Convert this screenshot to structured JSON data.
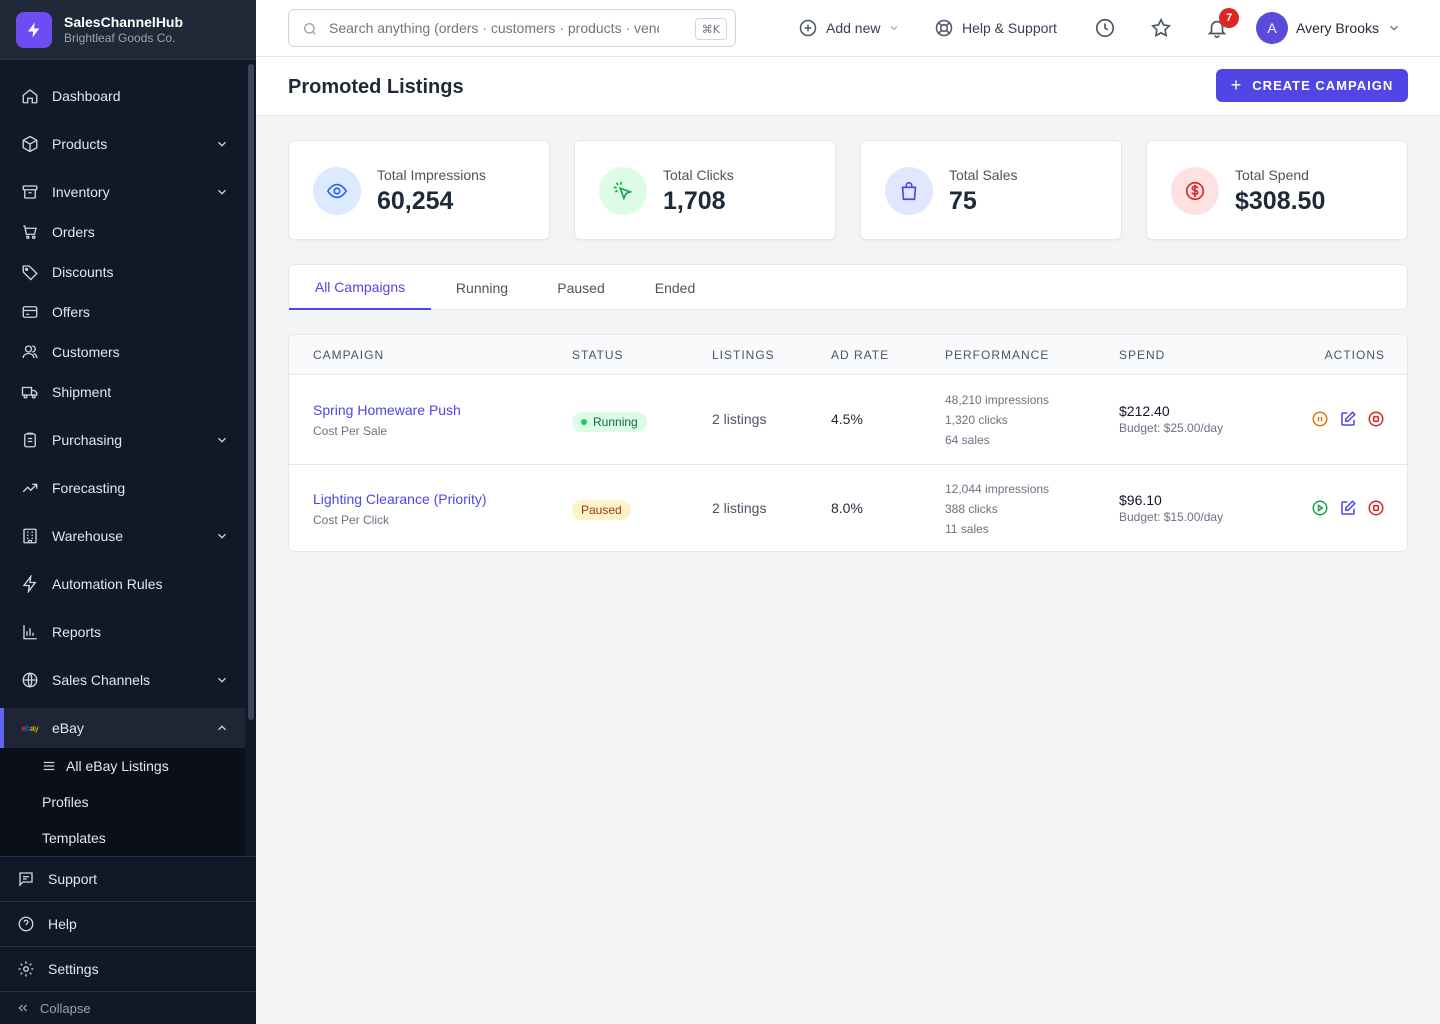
{
  "brand": {
    "name": "SalesChannelHub",
    "company": "Brightleaf Goods Co."
  },
  "sidebar": {
    "items": [
      {
        "label": "Dashboard"
      },
      {
        "label": "Products"
      },
      {
        "label": "Inventory"
      },
      {
        "label": "Orders"
      },
      {
        "label": "Discounts"
      },
      {
        "label": "Offers"
      },
      {
        "label": "Customers"
      },
      {
        "label": "Shipment"
      },
      {
        "label": "Purchasing"
      },
      {
        "label": "Forecasting"
      },
      {
        "label": "Warehouse"
      },
      {
        "label": "Automation Rules"
      },
      {
        "label": "Reports"
      },
      {
        "label": "Sales Channels"
      },
      {
        "label": "eBay"
      }
    ],
    "ebay_sub": [
      {
        "label": "All eBay Listings"
      },
      {
        "label": "Profiles"
      },
      {
        "label": "Templates"
      }
    ],
    "bottom": [
      {
        "label": "Support"
      },
      {
        "label": "Help"
      },
      {
        "label": "Settings"
      }
    ],
    "collapse_label": "Collapse"
  },
  "topbar": {
    "search_placeholder": "Search anything (orders · customers · products · vendors)",
    "search_shortcut": "⌘K",
    "add_new": "Add new",
    "help": "Help & Support",
    "notifications_count": "7",
    "user_initial": "A",
    "user_name": "Avery Brooks"
  },
  "page": {
    "title": "Promoted Listings",
    "create_button": "CREATE CAMPAIGN"
  },
  "stats": [
    {
      "label": "Total Impressions",
      "value": "60,254"
    },
    {
      "label": "Total Clicks",
      "value": "1,708"
    },
    {
      "label": "Total Sales",
      "value": "75"
    },
    {
      "label": "Total Spend",
      "value": "$308.50"
    }
  ],
  "tabs": [
    {
      "label": "All Campaigns"
    },
    {
      "label": "Running"
    },
    {
      "label": "Paused"
    },
    {
      "label": "Ended"
    }
  ],
  "table": {
    "headers": [
      "Campaign",
      "Status",
      "Listings",
      "Ad Rate",
      "Performance",
      "Spend",
      "Actions"
    ],
    "rows": [
      {
        "name": "Spring Homeware Push",
        "type": "Cost Per Sale",
        "status": "Running",
        "listings": "2 listings",
        "ad_rate": "4.5%",
        "impressions": "48,210 impressions",
        "clicks": "1,320 clicks",
        "sales": "64 sales",
        "spend": "$212.40",
        "budget": "Budget: $25.00/day"
      },
      {
        "name": "Lighting Clearance (Priority)",
        "type": "Cost Per Click",
        "status": "Paused",
        "listings": "2 listings",
        "ad_rate": "8.0%",
        "impressions": "12,044 impressions",
        "clicks": "388 clicks",
        "sales": "11 sales",
        "spend": "$96.10",
        "budget": "Budget: $15.00/day"
      }
    ]
  },
  "colors": {
    "accent": "#4f46e5",
    "sidebar_bg": "#111827",
    "running": "#16a34a",
    "paused": "#d97706",
    "danger": "#dc2626"
  }
}
